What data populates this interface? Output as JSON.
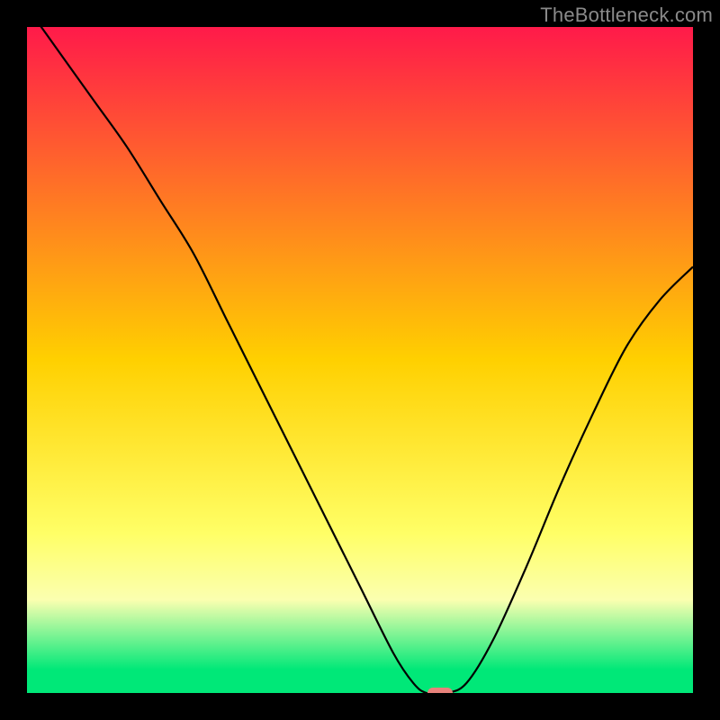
{
  "watermark": "TheBottleneck.com",
  "chart_data": {
    "type": "line",
    "title": "",
    "xlabel": "",
    "ylabel": "",
    "xlim": [
      0,
      100
    ],
    "ylim": [
      0,
      100
    ],
    "grid": false,
    "legend": false,
    "background_gradient": {
      "stops": [
        {
          "pos": 0.0,
          "color": "#ff1a4a"
        },
        {
          "pos": 0.5,
          "color": "#ffd000"
        },
        {
          "pos": 0.76,
          "color": "#ffff66"
        },
        {
          "pos": 0.86,
          "color": "#fbffb0"
        },
        {
          "pos": 0.965,
          "color": "#00e878"
        },
        {
          "pos": 1.0,
          "color": "#00e878"
        }
      ]
    },
    "series": [
      {
        "name": "bottleneck-curve",
        "color": "#000000",
        "x": [
          0,
          5,
          10,
          15,
          20,
          25,
          30,
          35,
          40,
          45,
          50,
          55,
          58,
          60,
          63,
          66,
          70,
          75,
          80,
          85,
          90,
          95,
          100
        ],
        "y": [
          103,
          96,
          89,
          82,
          74,
          66,
          56,
          46,
          36,
          26,
          16,
          6,
          1.5,
          0,
          0,
          1.5,
          8,
          19,
          31,
          42,
          52,
          59,
          64
        ]
      }
    ],
    "marker": {
      "x": 62,
      "y": 0,
      "color": "#e8827b"
    },
    "annotations": []
  }
}
